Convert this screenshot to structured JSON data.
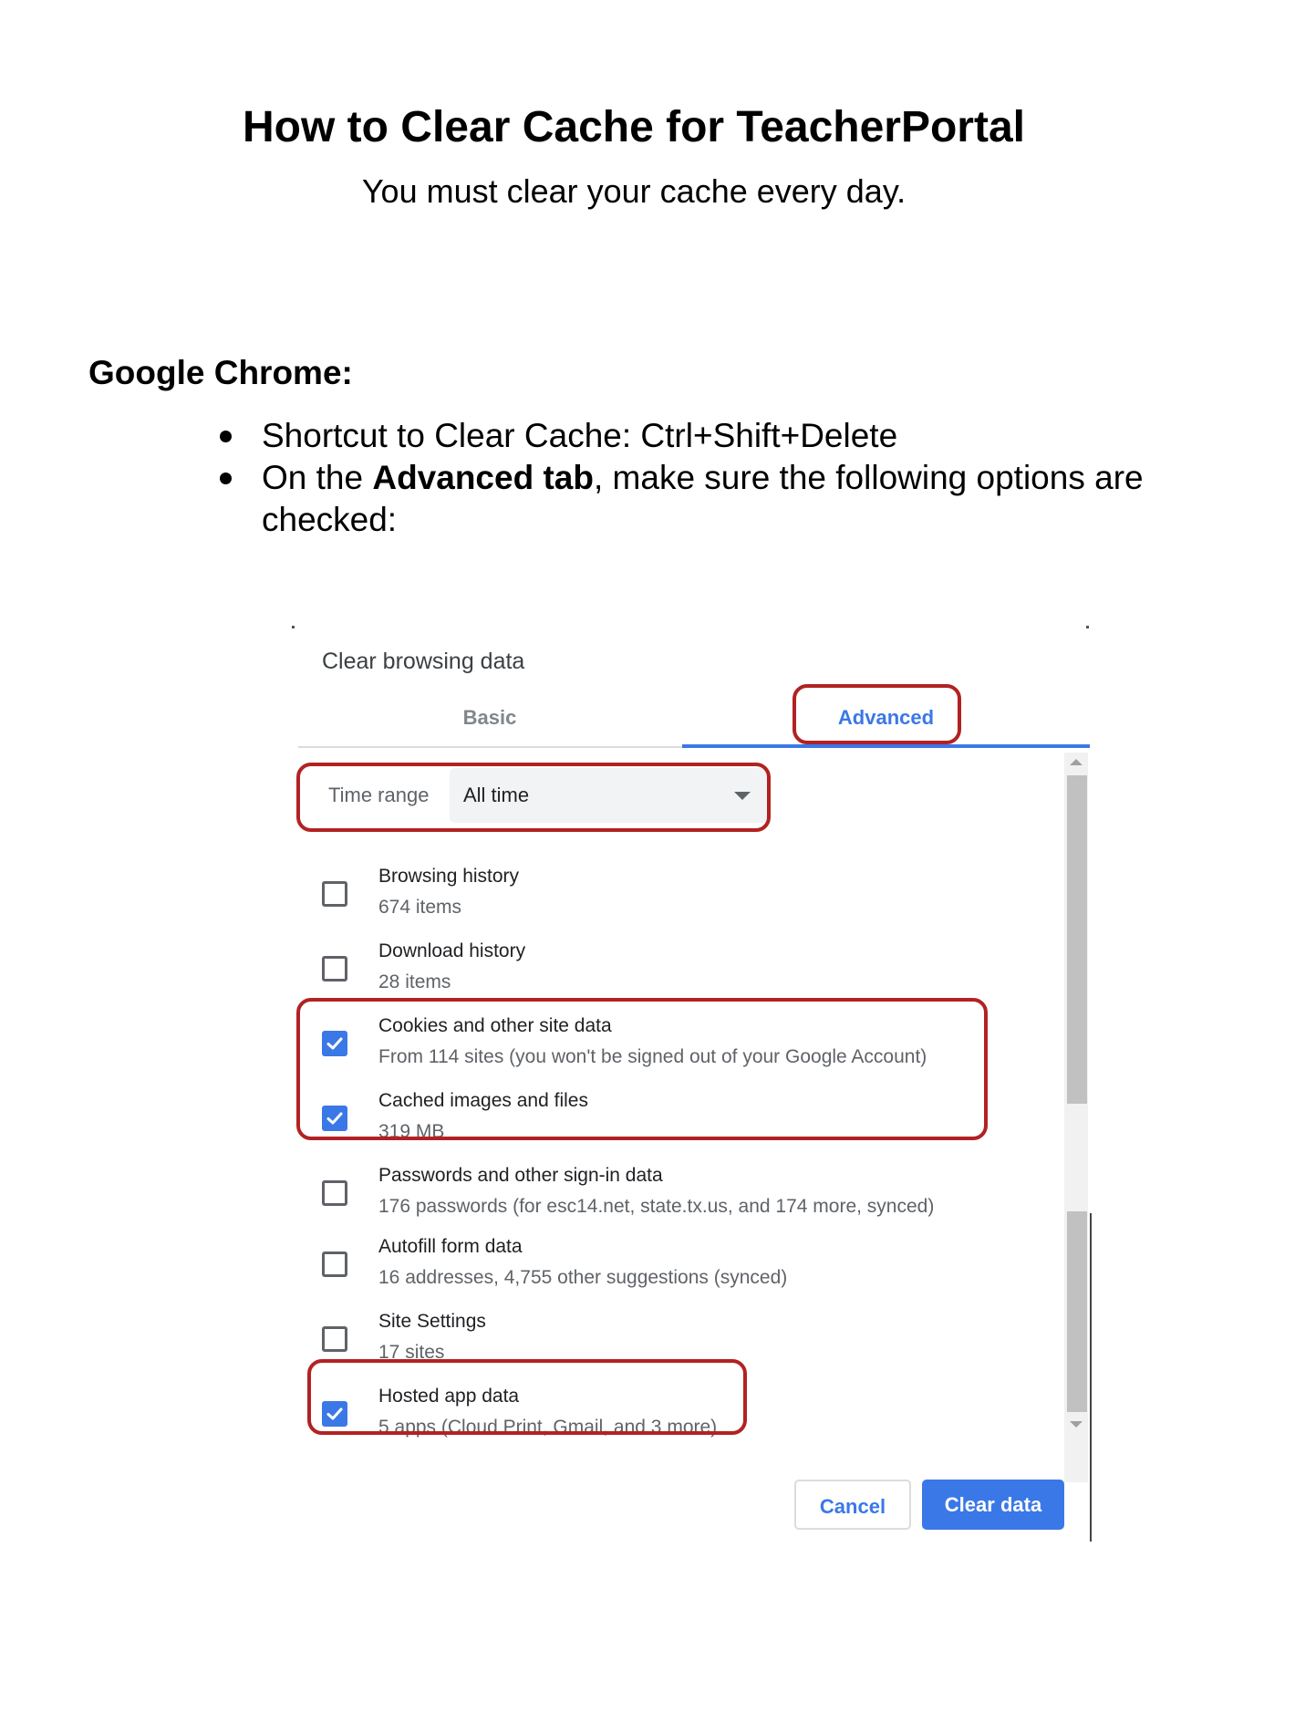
{
  "document": {
    "title": "How to Clear Cache for TeacherPortal",
    "subtitle": "You must clear your cache every day.",
    "section_heading": "Google Chrome:",
    "bullets": [
      {
        "text": "Shortcut to Clear Cache: Ctrl+Shift+Delete"
      },
      {
        "prefix": "On the ",
        "bold": "Advanced tab",
        "suffix": ", make sure the following options are checked:"
      }
    ]
  },
  "dialog": {
    "title": "Clear browsing data",
    "tabs": [
      {
        "label": "Basic",
        "active": false
      },
      {
        "label": "Advanced",
        "active": true
      }
    ],
    "time_range": {
      "label": "Time range",
      "value": "All time"
    },
    "options": [
      {
        "label": "Browsing history",
        "detail": "674 items",
        "checked": false
      },
      {
        "label": "Download history",
        "detail": "28 items",
        "checked": false
      },
      {
        "label": "Cookies and other site data",
        "detail": "From 114 sites (you won't be signed out of your Google Account)",
        "checked": true
      },
      {
        "label": "Cached images and files",
        "detail": "319 MB",
        "checked": true
      },
      {
        "label": "Passwords and other sign-in data",
        "detail": "176 passwords (for esc14.net, state.tx.us, and 174 more, synced)",
        "checked": false
      },
      {
        "label": "Autofill form data",
        "detail": "16 addresses, 4,755 other suggestions (synced)",
        "checked": false
      },
      {
        "label": "Site Settings",
        "detail": "17 sites",
        "checked": false
      },
      {
        "label": "Hosted app data",
        "detail": "5 apps (Cloud Print, Gmail, and 3 more)",
        "checked": true
      }
    ],
    "buttons": {
      "cancel": "Cancel",
      "clear": "Clear data"
    }
  },
  "colors": {
    "accent_blue": "#3b78e7",
    "annotation_red": "#b22222"
  }
}
